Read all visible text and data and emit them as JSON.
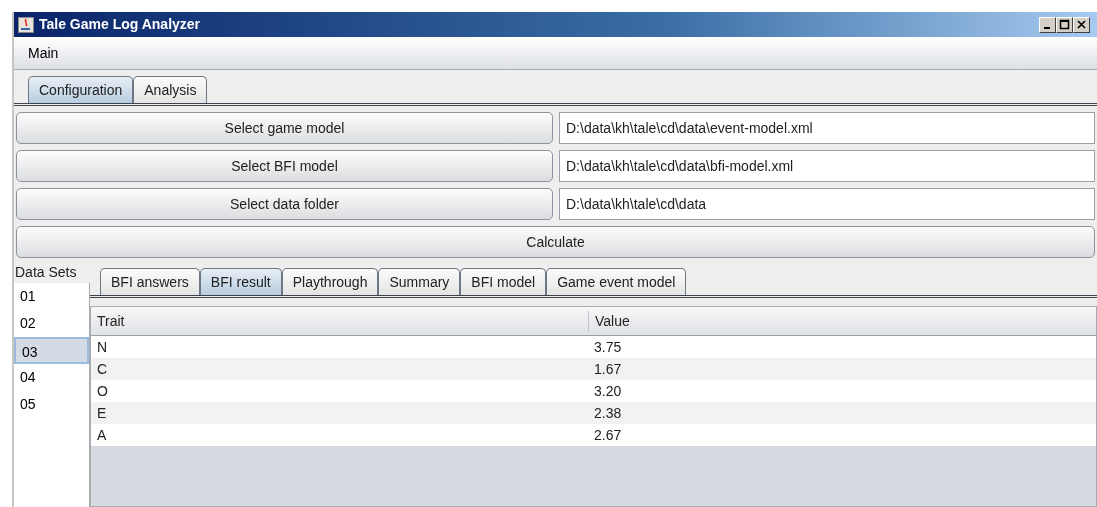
{
  "window": {
    "title": "Tale Game Log Analyzer"
  },
  "menu": [
    "Main"
  ],
  "tabs": [
    {
      "label": "Configuration",
      "selected": true
    },
    {
      "label": "Analysis",
      "selected": false
    }
  ],
  "file_rows": [
    {
      "button": "Select game model",
      "value": "D:\\data\\kh\\tale\\cd\\data\\event-model.xml"
    },
    {
      "button": "Select BFI model",
      "value": "D:\\data\\kh\\tale\\cd\\data\\bfi-model.xml"
    },
    {
      "button": "Select data folder",
      "value": "D:\\data\\kh\\tale\\cd\\data"
    }
  ],
  "calculate_button": "Calculate",
  "data_sets": {
    "label": "Data Sets",
    "items": [
      {
        "label": "01",
        "selected": false
      },
      {
        "label": "02",
        "selected": false
      },
      {
        "label": "03",
        "selected": true
      },
      {
        "label": "04",
        "selected": false
      },
      {
        "label": "05",
        "selected": false
      }
    ]
  },
  "result_tabs": [
    {
      "label": "BFI answers",
      "selected": false
    },
    {
      "label": "BFI result",
      "selected": true
    },
    {
      "label": "Playthrough",
      "selected": false
    },
    {
      "label": "Summary",
      "selected": false
    },
    {
      "label": "BFI model",
      "selected": false
    },
    {
      "label": "Game event model",
      "selected": false
    }
  ],
  "table": {
    "columns": [
      "Trait",
      "Value"
    ],
    "rows": [
      [
        "N",
        "3.75"
      ],
      [
        "C",
        "1.67"
      ],
      [
        "O",
        "3.20"
      ],
      [
        "E",
        "2.38"
      ],
      [
        "A",
        "2.67"
      ]
    ]
  }
}
